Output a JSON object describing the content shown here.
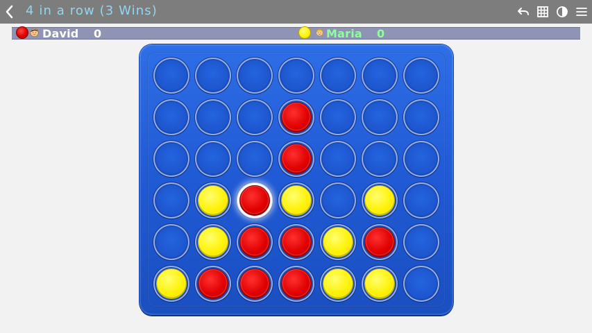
{
  "app": {
    "title": "4 in a row (3 Wins)"
  },
  "toolbar": {
    "icons": [
      "back-icon",
      "undo-icon",
      "grid-icon",
      "contrast-icon",
      "menu-icon"
    ]
  },
  "players": [
    {
      "name": "David",
      "score": "0",
      "chip_color": "#dd0000",
      "avatar": "boy-avatar"
    },
    {
      "name": "Maria",
      "score": "0",
      "chip_color": "#fff000",
      "avatar": "girl-avatar"
    }
  ],
  "board": {
    "columns": 7,
    "rows": 6,
    "grid": [
      [
        "empty",
        "empty",
        "empty",
        "empty",
        "empty",
        "empty",
        "empty"
      ],
      [
        "empty",
        "empty",
        "empty",
        "red",
        "empty",
        "empty",
        "empty"
      ],
      [
        "empty",
        "empty",
        "empty",
        "red",
        "empty",
        "empty",
        "empty"
      ],
      [
        "empty",
        "yellow",
        "red",
        "yellow",
        "empty",
        "yellow",
        "empty"
      ],
      [
        "empty",
        "yellow",
        "red",
        "red",
        "yellow",
        "red",
        "empty"
      ],
      [
        "yellow",
        "red",
        "red",
        "red",
        "yellow",
        "yellow",
        "empty"
      ]
    ],
    "highlighted": [
      3,
      2
    ]
  },
  "colors": {
    "topbar": "#7d7d7d",
    "title": "#93d6ee",
    "playerbar": "#8f94b5",
    "board": "#1f59d4",
    "red": "#dd0000",
    "yellow": "#fff000",
    "maria": "#8dff9b"
  }
}
